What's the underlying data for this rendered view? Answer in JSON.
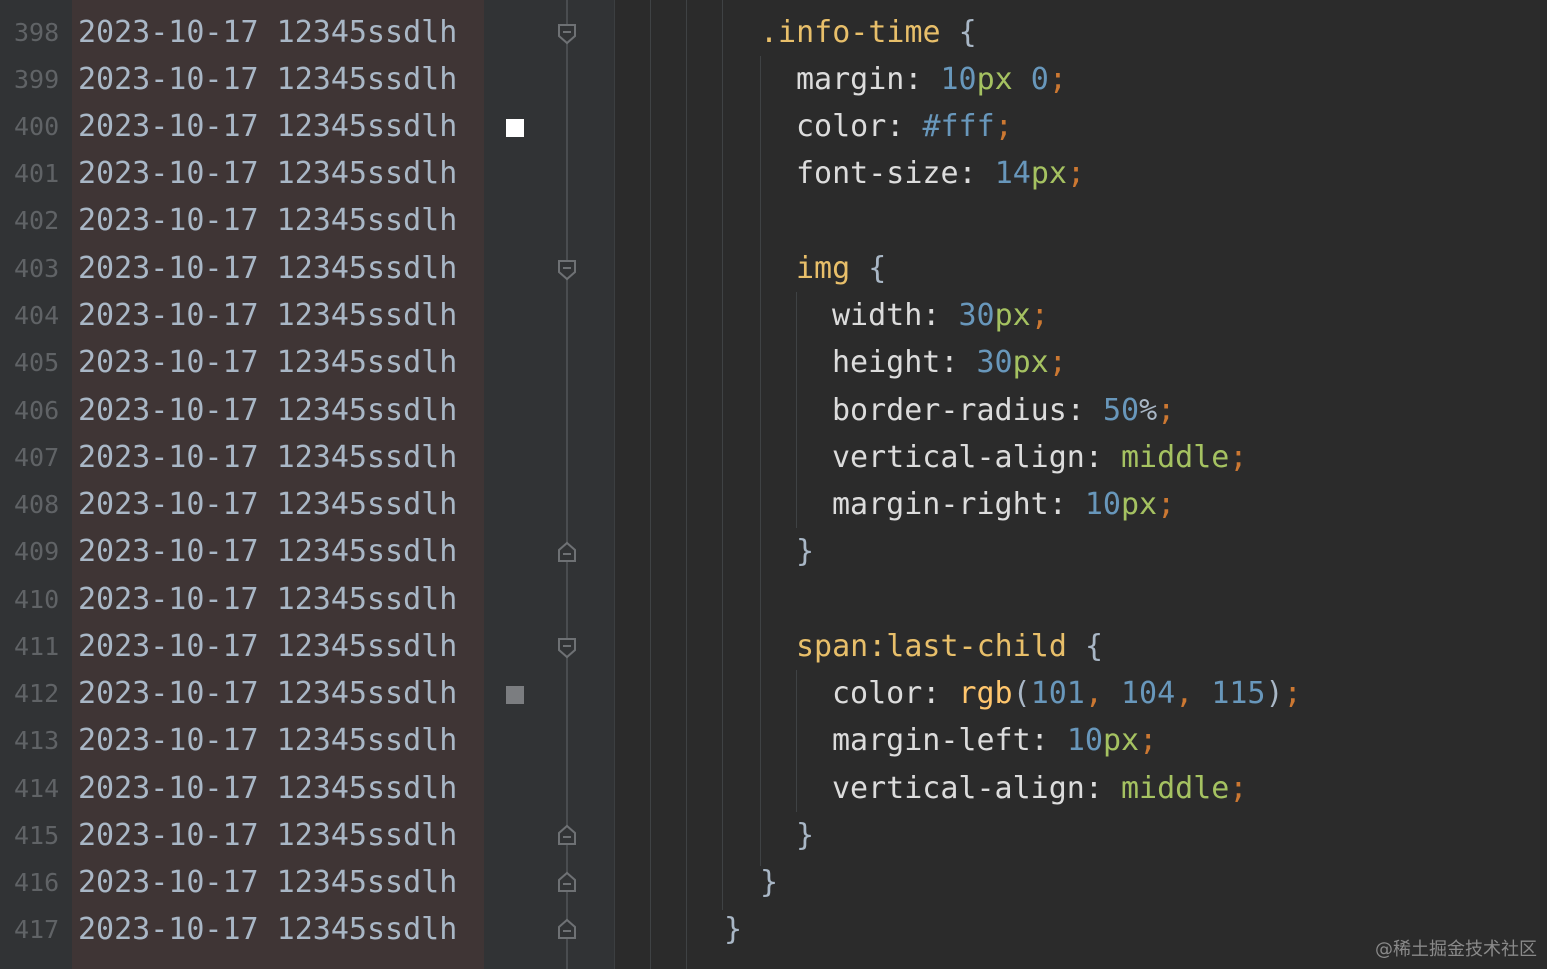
{
  "lines": [
    {
      "n": "398",
      "blame": "2023-10-17 12345ssdlh"
    },
    {
      "n": "399",
      "blame": "2023-10-17 12345ssdlh"
    },
    {
      "n": "400",
      "blame": "2023-10-17 12345ssdlh"
    },
    {
      "n": "401",
      "blame": "2023-10-17 12345ssdlh"
    },
    {
      "n": "402",
      "blame": "2023-10-17 12345ssdlh"
    },
    {
      "n": "403",
      "blame": "2023-10-17 12345ssdlh"
    },
    {
      "n": "404",
      "blame": "2023-10-17 12345ssdlh"
    },
    {
      "n": "405",
      "blame": "2023-10-17 12345ssdlh"
    },
    {
      "n": "406",
      "blame": "2023-10-17 12345ssdlh"
    },
    {
      "n": "407",
      "blame": "2023-10-17 12345ssdlh"
    },
    {
      "n": "408",
      "blame": "2023-10-17 12345ssdlh"
    },
    {
      "n": "409",
      "blame": "2023-10-17 12345ssdlh"
    },
    {
      "n": "410",
      "blame": "2023-10-17 12345ssdlh"
    },
    {
      "n": "411",
      "blame": "2023-10-17 12345ssdlh"
    },
    {
      "n": "412",
      "blame": "2023-10-17 12345ssdlh"
    },
    {
      "n": "413",
      "blame": "2023-10-17 12345ssdlh"
    },
    {
      "n": "414",
      "blame": "2023-10-17 12345ssdlh"
    },
    {
      "n": "415",
      "blame": "2023-10-17 12345ssdlh"
    },
    {
      "n": "416",
      "blame": "2023-10-17 12345ssdlh"
    },
    {
      "n": "417",
      "blame": "2023-10-17 12345ssdlh"
    }
  ],
  "code": {
    "l0_sel": ".info-time",
    "l0_brace": " {",
    "l1_prop": "margin: ",
    "l1_n1": "10",
    "l1_u1": "px",
    "l1_n2": " 0",
    "l1_semi": ";",
    "l2_prop": "color: ",
    "l2_val": "#fff",
    "l2_semi": ";",
    "l3_prop": "font-size: ",
    "l3_n": "14",
    "l3_u": "px",
    "l3_semi": ";",
    "l5_sel": "img",
    "l5_brace": " {",
    "l6_prop": "width: ",
    "l6_n": "30",
    "l6_u": "px",
    "l6_semi": ";",
    "l7_prop": "height: ",
    "l7_n": "30",
    "l7_u": "px",
    "l7_semi": ";",
    "l8_prop": "border-radius: ",
    "l8_n": "50",
    "l8_u": "%",
    "l8_semi": ";",
    "l9_prop": "vertical-align: ",
    "l9_kw": "middle",
    "l9_semi": ";",
    "l10_prop": "margin-right: ",
    "l10_n": "10",
    "l10_u": "px",
    "l10_semi": ";",
    "l11_brace": "}",
    "l13_sel": "span:last-child",
    "l13_brace": " {",
    "l14_prop": "color: ",
    "l14_fn": "rgb",
    "l14_p1": "(",
    "l14_n1": "101",
    "l14_c1": ", ",
    "l14_n2": "104",
    "l14_c2": ", ",
    "l14_n3": "115",
    "l14_p2": ")",
    "l14_semi": ";",
    "l15_prop": "margin-left: ",
    "l15_n": "10",
    "l15_u": "px",
    "l15_semi": ";",
    "l16_prop": "vertical-align: ",
    "l16_kw": "middle",
    "l16_semi": ";",
    "l17_brace": "}",
    "l18_brace": "}",
    "l19_brace": "}"
  },
  "watermark": "@稀土掘金技术社区"
}
